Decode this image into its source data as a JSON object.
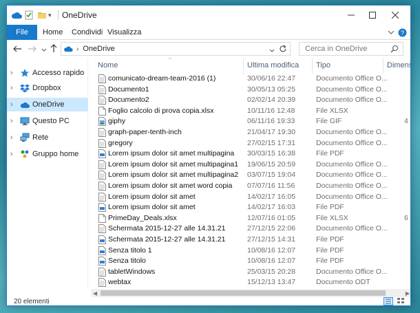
{
  "window": {
    "title": "OneDrive",
    "accent_color": "#1979ca"
  },
  "ribbon": {
    "tabs": [
      {
        "label": "File"
      },
      {
        "label": "Home"
      },
      {
        "label": "Condividi"
      },
      {
        "label": "Visualizza"
      }
    ]
  },
  "address": {
    "path": "OneDrive",
    "search_placeholder": "Cerca in OneDrive"
  },
  "nav": {
    "items": [
      {
        "label": "Accesso rapido",
        "icon": "star-icon"
      },
      {
        "label": "Dropbox",
        "icon": "dropbox-icon"
      },
      {
        "label": "OneDrive",
        "icon": "cloud-icon",
        "selected": true
      },
      {
        "label": "Questo PC",
        "icon": "computer-icon"
      },
      {
        "label": "Rete",
        "icon": "network-icon"
      },
      {
        "label": "Gruppo home",
        "icon": "homegroup-icon"
      }
    ]
  },
  "columns": {
    "name": "Nome",
    "modified": "Ultima modifica",
    "type": "Tipo",
    "size": "Dimensi"
  },
  "files": [
    {
      "name": "comunicato-dream-team-2016 (1)",
      "modified": "30/06/16 22:47",
      "type": "Documento Office O...",
      "size": "",
      "icon": "doc"
    },
    {
      "name": "Documento1",
      "modified": "30/05/13 05:25",
      "type": "Documento Office O...",
      "size": "",
      "icon": "doc"
    },
    {
      "name": "Documento2",
      "modified": "02/02/14 20:39",
      "type": "Documento Office O...",
      "size": "",
      "icon": "doc"
    },
    {
      "name": "Foglio calcolo di prova copia.xlsx",
      "modified": "10/11/16 12:48",
      "type": "File XLSX",
      "size": "",
      "icon": "blank"
    },
    {
      "name": "giphy",
      "modified": "06/11/16 19:33",
      "type": "File GIF",
      "size": "4",
      "icon": "img"
    },
    {
      "name": "graph-paper-tenth-inch",
      "modified": "21/04/17 19:30",
      "type": "Documento Office O...",
      "size": "",
      "icon": "doc"
    },
    {
      "name": "gregory",
      "modified": "27/02/15 17:31",
      "type": "Documento Office O...",
      "size": "",
      "icon": "doc"
    },
    {
      "name": "Lorem ipsum dolor sit amet multipagina",
      "modified": "30/03/15 16:38",
      "type": "File PDF",
      "size": "",
      "icon": "pdf"
    },
    {
      "name": "Lorem ipsum dolor sit amet multipagina1",
      "modified": "19/06/15 20:59",
      "type": "Documento Office O...",
      "size": "",
      "icon": "doc"
    },
    {
      "name": "Lorem ipsum dolor sit amet multipagina2",
      "modified": "03/07/15 19:04",
      "type": "Documento Office O...",
      "size": "",
      "icon": "doc"
    },
    {
      "name": "Lorem ipsum dolor sit amet word copia",
      "modified": "07/07/16 11:56",
      "type": "Documento Office O...",
      "size": "",
      "icon": "doc"
    },
    {
      "name": "Lorem ipsum dolor sit amet",
      "modified": "14/02/17 16:05",
      "type": "Documento Office O...",
      "size": "",
      "icon": "doc"
    },
    {
      "name": "Lorem ipsum dolor sit amet",
      "modified": "14/02/17 16:03",
      "type": "File PDF",
      "size": "",
      "icon": "pdf"
    },
    {
      "name": "PrimeDay_Deals.xlsx",
      "modified": "12/07/16 01:05",
      "type": "File XLSX",
      "size": "6",
      "icon": "blank"
    },
    {
      "name": "Schermata 2015-12-27 alle 14.31.21",
      "modified": "27/12/15 22:06",
      "type": "Documento Office O...",
      "size": "",
      "icon": "doc"
    },
    {
      "name": "Schermata 2015-12-27 alle 14.31.21",
      "modified": "27/12/15 14:31",
      "type": "File PDF",
      "size": "",
      "icon": "pdf"
    },
    {
      "name": "Senza titolo 1",
      "modified": "10/08/16 12:07",
      "type": "File PDF",
      "size": "",
      "icon": "pdf"
    },
    {
      "name": "Senza titolo",
      "modified": "10/08/16 12:07",
      "type": "File PDF",
      "size": "",
      "icon": "pdf"
    },
    {
      "name": "tabletWindows",
      "modified": "25/03/15 20:28",
      "type": "Documento Office O...",
      "size": "",
      "icon": "doc"
    },
    {
      "name": "webtax",
      "modified": "15/12/13 13:47",
      "type": "Documento ODT",
      "size": "",
      "icon": "doc"
    }
  ],
  "status": {
    "count": "20 elementi"
  }
}
